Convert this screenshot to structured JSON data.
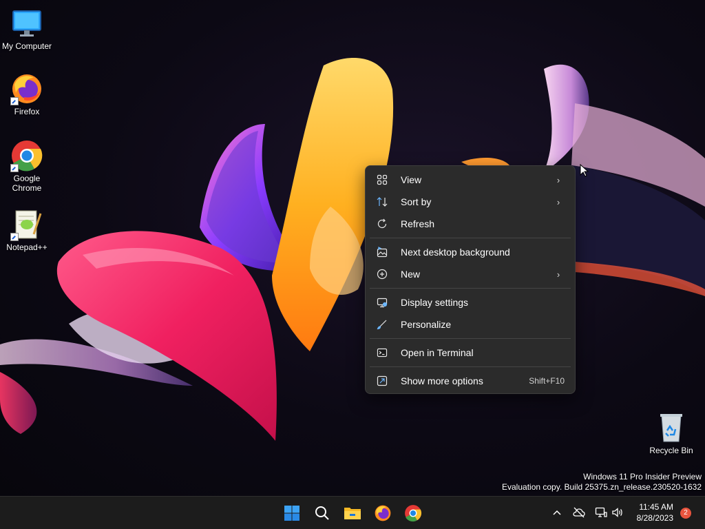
{
  "desktop": {
    "icons": [
      {
        "label": "My Computer",
        "icon": "monitor-icon"
      },
      {
        "label": "Firefox",
        "icon": "firefox-icon"
      },
      {
        "label": "Google Chrome",
        "icon": "chrome-icon"
      },
      {
        "label": "Notepad++",
        "icon": "notepad-plus-plus-icon"
      },
      {
        "label": "Recycle Bin",
        "icon": "recycle-bin-icon"
      }
    ],
    "watermark": {
      "line1": "Windows 11 Pro Insider Preview",
      "line2": "Evaluation copy. Build 25375.zn_release.230520-1632"
    }
  },
  "context_menu": {
    "items": [
      {
        "label": "View",
        "icon": "grid-icon",
        "submenu": true
      },
      {
        "label": "Sort by",
        "icon": "sort-icon",
        "submenu": true
      },
      {
        "label": "Refresh",
        "icon": "refresh-icon"
      },
      {
        "label": "Next desktop background",
        "icon": "image-next-icon"
      },
      {
        "label": "New",
        "icon": "plus-circle-icon",
        "submenu": true
      },
      {
        "label": "Display settings",
        "icon": "display-icon"
      },
      {
        "label": "Personalize",
        "icon": "brush-icon"
      },
      {
        "label": "Open in Terminal",
        "icon": "terminal-icon"
      },
      {
        "label": "Show more options",
        "icon": "more-options-icon",
        "shortcut": "Shift+F10"
      }
    ]
  },
  "taskbar": {
    "apps": [
      "start-icon",
      "search-icon",
      "file-explorer-icon",
      "firefox-icon",
      "chrome-icon"
    ],
    "tray": [
      "chevron-up-icon",
      "cloud-off-icon",
      "network-icon",
      "volume-icon"
    ],
    "clock": {
      "time": "11:45 AM",
      "date": "8/28/2023"
    },
    "notification_count": "2"
  },
  "colors": {
    "menu_bg": "#2b2b2b",
    "taskbar_bg": "#1c1c1c",
    "accent": "#0078d4"
  }
}
